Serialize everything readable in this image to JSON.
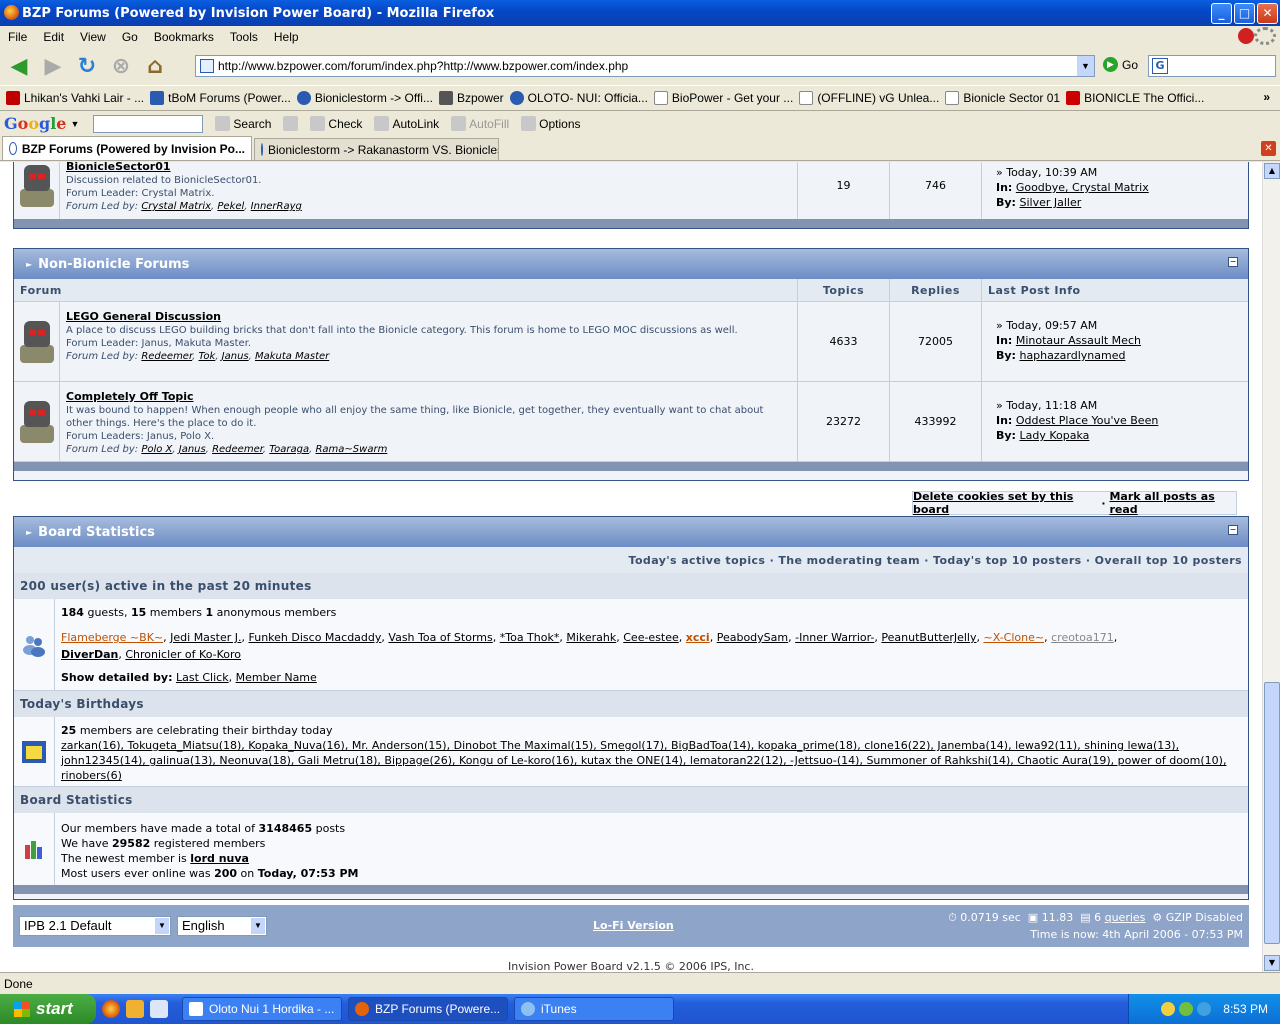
{
  "window": {
    "title": "BZP Forums (Powered by Invision Power Board) - Mozilla Firefox",
    "min": "_",
    "max": "□",
    "close": "✕"
  },
  "menu": [
    "File",
    "Edit",
    "View",
    "Go",
    "Bookmarks",
    "Tools",
    "Help"
  ],
  "nav": {
    "url": "http://www.bzpower.com/forum/index.php?http://www.bzpower.com/index.php",
    "go": "Go"
  },
  "bookmarks": [
    {
      "label": "Lhikan's Vahki Lair - ...",
      "color": "#c00000"
    },
    {
      "label": "tBoM Forums (Power...",
      "color": "#2a5bb0"
    },
    {
      "label": "Bionicle­storm -> Offi...",
      "color": "#2a5bb0"
    },
    {
      "label": "Bzpower",
      "color": "#555555"
    },
    {
      "label": "OLOTO- NUI: Officia...",
      "color": "#2a5bb0"
    },
    {
      "label": "BioPower - Get your ...",
      "color": "#dddddd"
    },
    {
      "label": "(OFFLINE) vG Unlea...",
      "color": "#dddddd"
    },
    {
      "label": "Bionicle Sector 01",
      "color": "#dddddd"
    },
    {
      "label": "BIONICLE The Offici...",
      "color": "#cc0000"
    }
  ],
  "bookmarks_more": "»",
  "google": {
    "logo": "Google",
    "search": "Search",
    "check": "Check",
    "autolink": "AutoLink",
    "autofill": "AutoFill",
    "options": "Options"
  },
  "tabs": [
    {
      "label": "BZP Forums (Powered by Invision Po..."
    },
    {
      "label": "Bionicle­storm -> Rakanastorm VS. Bionicle­st..."
    }
  ],
  "sector_row": {
    "name": "BionicleSector01",
    "desc": "Discussion related to BionicleSector01.",
    "leader": "Forum Leader: Crystal Matrix.",
    "led_label": "Forum Led by:",
    "led": [
      "Crystal Matrix",
      "Pekel",
      "InnerRayg"
    ],
    "topics": "19",
    "replies": "746",
    "last_date": "» Today, 10:39 AM",
    "in_label": "In:",
    "in": "Goodbye, Crystal Matrix",
    "by_label": "By:",
    "by": "Silver Jaller"
  },
  "nonbionicle": {
    "title": "Non-Bionicle Forums",
    "cols": {
      "forum": "Forum",
      "topics": "Topics",
      "replies": "Replies",
      "last": "Last Post Info"
    },
    "rows": [
      {
        "name": "LEGO General Discussion",
        "desc": "A place to discuss LEGO building bricks that don't fall into the Bionicle category. This forum is home to LEGO MOC discussions as well.",
        "leader": "Forum Leader: Janus, Makuta Master.",
        "led": [
          "Redeemer",
          "Tok",
          "Janus",
          "Makuta Master"
        ],
        "topics": "4633",
        "replies": "72005",
        "last_date": "» Today, 09:57 AM",
        "in": "Minotaur Assault Mech",
        "by": "haphazardlynamed"
      },
      {
        "name": "Completely Off Topic",
        "desc": "It was bound to happen! When enough people who all enjoy the same thing, like Bionicle, get together, they eventually want to chat about other things. Here's the place to do it.",
        "leader": "Forum Leaders: Janus, Polo X.",
        "led": [
          "Polo X",
          "Janus",
          "Redeemer",
          "Toaraga",
          "Rama~Swarm"
        ],
        "topics": "23272",
        "replies": "433992",
        "last_date": "» Today, 11:18 AM",
        "in": "Oddest Place You've Been",
        "by": "Lady Kopaka"
      }
    ]
  },
  "cookies": {
    "delete": "Delete cookies set by this board",
    "sep": "·",
    "mark": "Mark all posts as read"
  },
  "stats": {
    "title": "Board Statistics",
    "links": "Today's active topics · The moderating team · Today's top 10 posters · Overall top 10 posters",
    "active_head": "200 user(s) active in the past 20 minutes",
    "guests": "184",
    "guests_label": "guests,",
    "members": "15",
    "members_label": "members",
    "anon": "1",
    "anon_label": "anonymous members",
    "online": [
      "Flameberge ~BK~",
      "Jedi Master J.",
      "Funkeh Disco Macdaddy",
      "Vash Toa of Storms",
      "*Toa Thok*",
      "Mikerahk",
      "Cee-estee",
      "xcci",
      "PeabodySam",
      "-Inner Warrior-",
      "PeanutButterJelly",
      "~X-Clone~",
      "creotoa171",
      "DiverDan",
      "Chronicler of Ko-Koro"
    ],
    "detail_label": "Show detailed by:",
    "detail_click": "Last Click",
    "detail_name": "Member Name",
    "bday_head": "Today's Birthdays",
    "bday_count": "25",
    "bday_text": "members are celebrating their birthday today",
    "bdays": "zarkan(16), Tokugeta_Miatsu(18), Kopaka_Nuva(16), Mr. Anderson(15), Dinobot The Maximal(15), Smegol(17), BigBadToa(14), kopaka_prime(18), clone16(22), Janemba(14), lewa92(11), shining lewa(13), john12345(14), galinua(13), Neonuva(18), Gali Metru(18), Bippage(26), Kongu of Le-koro(16), kutax the ONE(14), lematoran22(12), -Jettsuo-(14), Summoner of Rahkshi(14), Chaotic Aura(19), power of doom(10), rinobers(6)",
    "bs_head": "Board Statistics",
    "posts_pre": "Our members have made a total of",
    "posts": "3148465",
    "posts_post": "posts",
    "reg_pre": "We have",
    "reg": "29582",
    "reg_post": "registered members",
    "newest_pre": "The newest member is",
    "newest": "lord nuva",
    "most_pre": "Most users ever online was",
    "most": "200",
    "most_on": "on",
    "most_date": "Today, 07:53 PM"
  },
  "footer": {
    "skin": "IPB 2.1 Default",
    "lang": "English",
    "lofi": "Lo-Fi Version",
    "time": "0.0719 sec",
    "load": "11.83",
    "queries": "6",
    "queries_label": "queries",
    "gzip": "GZIP Disabled",
    "now": "Time is now: 4th April 2006 - 07:53 PM",
    "copyright": "Invision Power Board v2.1.5 © 2006  IPS, Inc."
  },
  "status": "Done",
  "taskbar": {
    "start": "start",
    "tasks": [
      "Oloto Nui 1 Hordika - ...",
      "BZP Forums (Powere...",
      "iTunes"
    ],
    "clock": "8:53 PM"
  }
}
